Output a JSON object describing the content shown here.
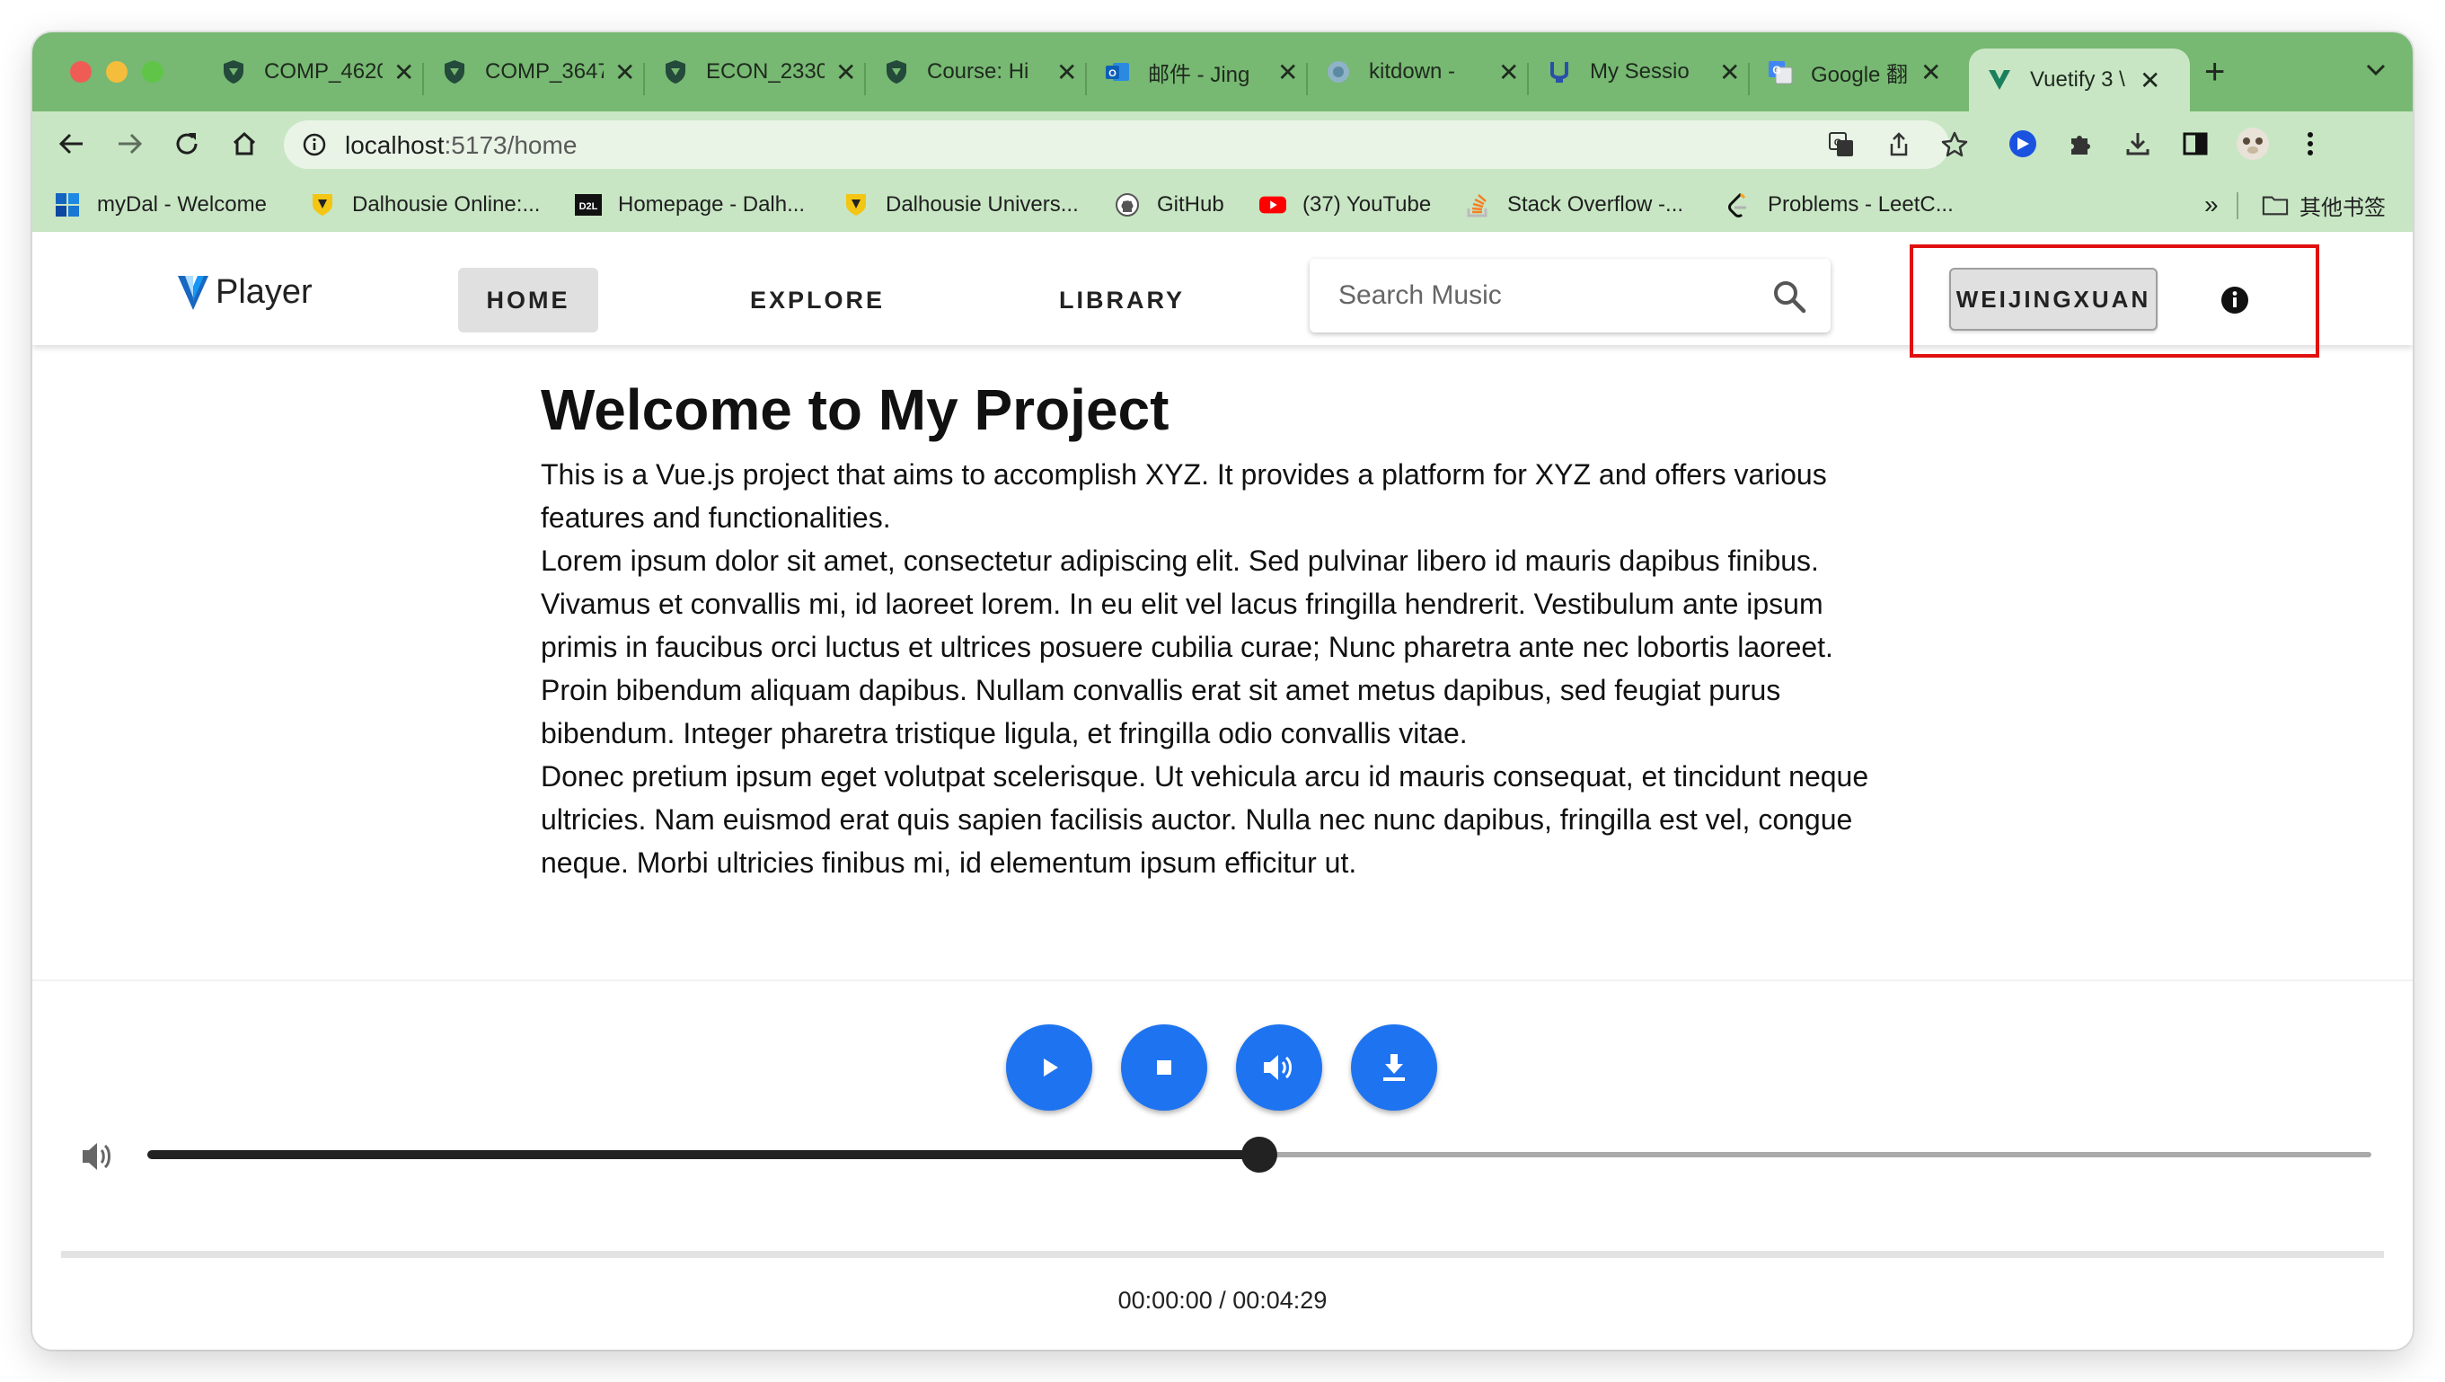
{
  "browser": {
    "tabs": [
      {
        "label": "COMP_4620",
        "icon": "shield-icon"
      },
      {
        "label": "COMP_3647",
        "icon": "shield-icon"
      },
      {
        "label": "ECON_2330",
        "icon": "shield-icon"
      },
      {
        "label": "Course: Hi",
        "icon": "shield-icon"
      },
      {
        "label": "邮件 - Jing",
        "icon": "outlook-icon"
      },
      {
        "label": "kitdown -",
        "icon": "github-icon"
      },
      {
        "label": "My Sessio",
        "icon": "u-icon"
      },
      {
        "label": "Google 翻",
        "icon": "translate-icon"
      },
      {
        "label": "Vuetify 3 \\",
        "icon": "vuetify-icon",
        "active": true
      }
    ],
    "url_host": "localhost",
    "url_path": ":5173/home",
    "bookmarks": [
      {
        "label": "myDal - Welcome",
        "icon": "windows-icon"
      },
      {
        "label": "Dalhousie Online:...",
        "icon": "dal-icon"
      },
      {
        "label": "Homepage - Dalh...",
        "icon": "d2l-icon"
      },
      {
        "label": "Dalhousie Univers...",
        "icon": "dal-icon"
      },
      {
        "label": "GitHub",
        "icon": "github-icon"
      },
      {
        "label": "(37) YouTube",
        "icon": "youtube-icon"
      },
      {
        "label": "Stack Overflow -...",
        "icon": "stackoverflow-icon"
      },
      {
        "label": "Problems - LeetC...",
        "icon": "leetcode-icon"
      }
    ],
    "more_bookmarks": "»",
    "other_bookmarks": "其他书签",
    "colors": {
      "tab_strip": "#77b872",
      "toolbar": "#c8e6c4"
    }
  },
  "app": {
    "logo_text": "Player",
    "nav": [
      "HOME",
      "EXPLORE",
      "LIBRARY"
    ],
    "active_nav": "HOME",
    "search_placeholder": "Search Music",
    "user_button": "WEIJINGXUAN",
    "accent": "#1e74f0"
  },
  "content": {
    "title": "Welcome to My Project",
    "paragraphs": [
      "This is a Vue.js project that aims to accomplish XYZ. It provides a platform for XYZ and offers various features and functionalities.",
      "Lorem ipsum dolor sit amet, consectetur adipiscing elit. Sed pulvinar libero id mauris dapibus finibus. Vivamus et convallis mi, id laoreet lorem. In eu elit vel lacus fringilla hendrerit. Vestibulum ante ipsum primis in faucibus orci luctus et ultrices posuere cubilia curae; Nunc pharetra ante nec lobortis laoreet. Proin bibendum aliquam dapibus. Nullam convallis erat sit amet metus dapibus, sed feugiat purus bibendum. Integer pharetra tristique ligula, et fringilla odio convallis vitae.",
      "Donec pretium ipsum eget volutpat scelerisque. Ut vehicula arcu id mauris consequat, et tincidunt neque ultricies. Nam euismod erat quis sapien facilisis auctor. Nulla nec nunc dapibus, fringilla est vel, congue neque. Morbi ultricies finibus mi, id elementum ipsum efficitur ut."
    ]
  },
  "player": {
    "buttons": [
      "play-icon",
      "stop-icon",
      "volume-icon",
      "download-icon"
    ],
    "volume_level": 0.5,
    "playback_progress": 0,
    "time_text": "00:00:00 / 00:04:29"
  }
}
